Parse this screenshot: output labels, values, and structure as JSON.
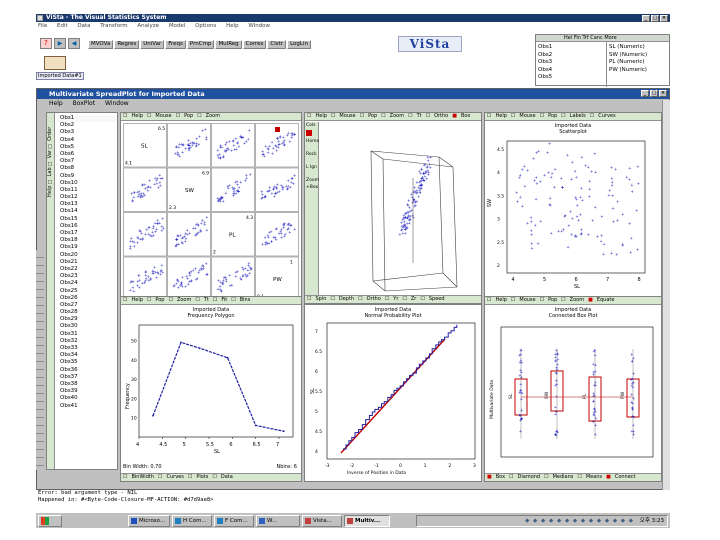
{
  "main_window": {
    "title": "ViSta - The Visual Statistics System",
    "menu": [
      "File",
      "Edit",
      "Data",
      "Transform",
      "Analyze",
      "Model",
      "Options",
      "Help",
      "Window"
    ],
    "toolbar_buttons": [
      "MVOVa",
      "Regres",
      "UniVar",
      "Freqs",
      "PrnCmp",
      "MulReg",
      "Corres",
      "Clstr",
      "LogLin"
    ],
    "logo": "ViSta",
    "data_icon_label": "Imported Data#1"
  },
  "var_list": {
    "top_labels": [
      "Obs1",
      "Obs2",
      "Obs3",
      "Obs4",
      "Obs5"
    ],
    "header_items": [
      "Hel",
      "Fin",
      "Trf",
      "Canc",
      "More"
    ],
    "variables": [
      "SL (Numeric)",
      "SW (Numeric)",
      "PL (Numeric)",
      "PW (Numeric)"
    ]
  },
  "spreadplot": {
    "title": "Multivariate SpreadPlot for Imported Data",
    "menu": [
      "Help",
      "BoxPlot",
      "Window"
    ],
    "obs_list_header": [
      "Help",
      "Lab",
      "Var",
      "Order"
    ],
    "obs_labels": [
      "Obs1",
      "Obs2",
      "Obs3",
      "Obs4",
      "Obs5",
      "Obs6",
      "Obs7",
      "Obs8",
      "Obs9",
      "Obs10",
      "Obs11",
      "Obs12",
      "Obs13",
      "Obs14",
      "Obs15",
      "Obs16",
      "Obs17",
      "Obs18",
      "Obs19",
      "Obs20",
      "Obs21",
      "Obs22",
      "Obs23",
      "Obs24",
      "Obs25",
      "Obs26",
      "Obs27",
      "Obs28",
      "Obs29",
      "Obs30",
      "Obs31",
      "Obs32",
      "Obs33",
      "Obs34",
      "Obs35",
      "Obs36",
      "Obs37",
      "Obs38",
      "Obs39",
      "Obs40",
      "Obs41"
    ],
    "panels": {
      "matrix": {
        "top_bar": [
          "Help",
          "Mouse",
          "Pop",
          "Zoom"
        ],
        "diag_labels": [
          "SL",
          "SW",
          "PL",
          "PW"
        ],
        "bottom_bar": [
          "Help",
          "Pop",
          "Zoom",
          "Tt",
          "Fit",
          "Bins"
        ],
        "tick_labels": [
          "6.5",
          "4.1",
          "6.9",
          "2.3",
          "4.3",
          "2",
          "1",
          "0.1"
        ]
      },
      "spin": {
        "top_bar": [
          "Help",
          "Mouse",
          "Pop",
          "Zoom",
          "Tt",
          "Ortho",
          "Box"
        ],
        "side_labels": [
          "Cols",
          "Home",
          "Rock",
          "L Ign",
          "Zoom",
          "+Box"
        ],
        "bottom_bar": [
          "Spin",
          "Depth",
          "Ortho",
          "Yr",
          "Zr",
          "Speed"
        ]
      },
      "scatter": {
        "top_bar": [
          "Help",
          "Mouse",
          "Pop",
          "Labels",
          "Curves"
        ],
        "title_line1": "Imported Data",
        "title_line2": "Scatterplot",
        "xlabel": "SL",
        "ylabel": "SW",
        "xticks": [
          "4",
          "5",
          "6",
          "7",
          "8"
        ],
        "yticks": [
          "2",
          "2.5",
          "3",
          "3.5",
          "4",
          "4.5"
        ]
      },
      "freq": {
        "title_line1": "Imported Data",
        "title_line2": "Frequency Polygon",
        "xlabel": "SL",
        "ylabel": "Frequency",
        "xticks": [
          "4",
          "4.5",
          "5",
          "5.5",
          "6",
          "6.5",
          "7"
        ],
        "yticks": [
          "10",
          "20",
          "30",
          "40",
          "50"
        ],
        "bottom_bar": [
          "Bin Width: 0.70",
          "Nbins: 6"
        ],
        "bottom_buttons": [
          "BinWidth",
          "Curves",
          "Plots",
          "Data"
        ],
        "chart_data": {
          "type": "line",
          "x": [
            4.3,
            4.9,
            5.3,
            5.9,
            6.5,
            7.1
          ],
          "values": [
            11,
            49,
            46,
            41,
            6,
            3
          ],
          "xlim": [
            4,
            7.3
          ],
          "ylim": [
            0,
            58
          ]
        }
      },
      "normal": {
        "title_line1": "Imported Data",
        "title_line2": "Normal Probability Plot",
        "xlabel": "Inverse of Position in Data",
        "ylabel": "SL",
        "xticks": [
          "-3",
          "-2",
          "-1",
          "0",
          "1",
          "2",
          "3"
        ],
        "yticks": [
          "4",
          "4.5",
          "5",
          "5.5",
          "6",
          "6.5",
          "7"
        ]
      },
      "box": {
        "top_bar": [
          "Help",
          "Mouse",
          "Pop",
          "Zoom",
          "Equate"
        ],
        "title_line1": "Imported Data",
        "title_line2": "Connected Box Plot",
        "ylabel": "Multivariate Data",
        "categories": [
          "SL",
          "SW",
          "PL",
          "PW"
        ],
        "bottom_bar": [
          "Box",
          "Diamond",
          "Medians",
          "Means",
          "Connect"
        ]
      }
    }
  },
  "listener": {
    "line1": "Error: bad argument type - NIL",
    "line2": "Happened in: #<Byte-Code-Closure-MF-ACTION: #d7d9ae8>"
  },
  "taskbar": {
    "buttons": [
      "Microso...",
      "H Com...",
      "F Com...",
      "W...",
      "Vista...",
      "Multiv..."
    ],
    "tray_time": "오후 3:23"
  },
  "colors": {
    "point": "#2020c0",
    "fit_line": "#c00000",
    "green_bar": "#d8e8d0"
  }
}
